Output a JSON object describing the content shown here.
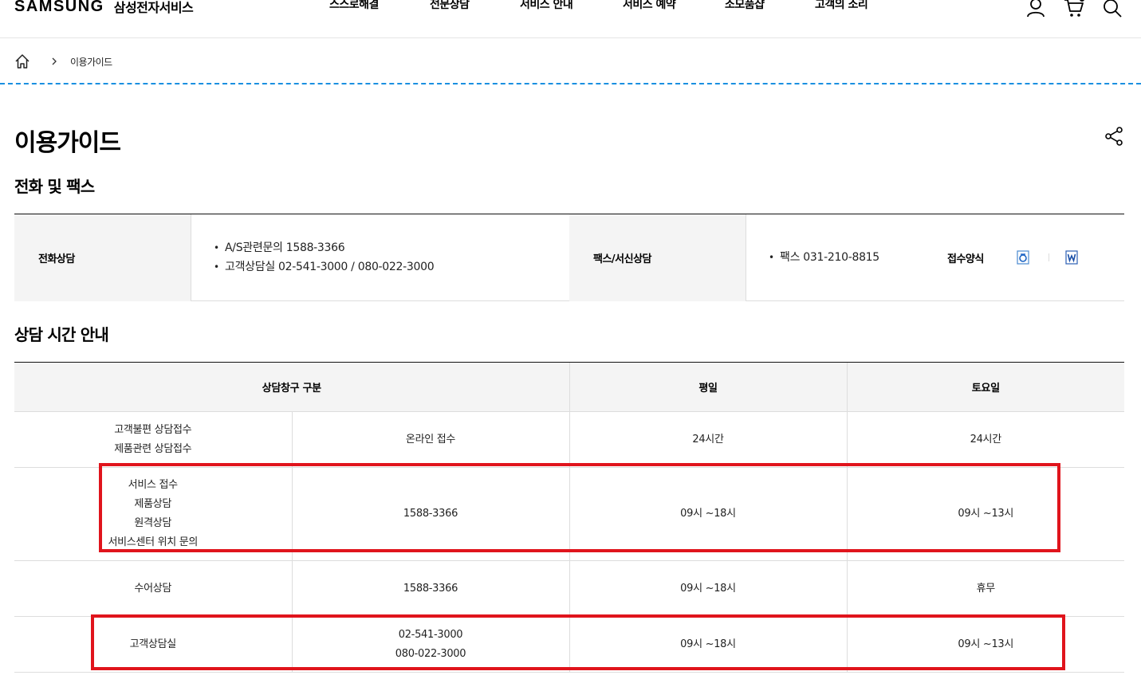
{
  "header": {
    "brand": "SAMSUNG",
    "brand_sub": "삼성전자서비스",
    "nav": [
      "스스로해결",
      "전문상담",
      "서비스 안내",
      "서비스 예약",
      "소모품샵",
      "고객의 소리"
    ]
  },
  "breadcrumb": {
    "current": "이용가이드"
  },
  "page_title": "이용가이드",
  "contact_section": {
    "title": "전화 및 팩스",
    "phone_label": "전화상담",
    "phone_items": [
      "A/S관련문의 1588-3366",
      "고객상담실 02-541-3000 / 080-022-3000"
    ],
    "fax_label": "팩스/서신상담",
    "fax_items": [
      "팩스 031-210-8815"
    ],
    "form_label": "접수양식",
    "form_icons": [
      "hwp-file-icon",
      "word-file-icon"
    ]
  },
  "hours_section": {
    "title": "상담 시간 안내",
    "headers": [
      "상담창구 구분",
      "평일",
      "토요일"
    ],
    "rows": [
      {
        "category": [
          "고객불편 상담접수",
          "제품관련 상담접수"
        ],
        "channel": [
          "온라인 접수"
        ],
        "weekday": "24시간",
        "saturday": "24시간"
      },
      {
        "category": [
          "서비스 접수",
          "제품상담",
          "원격상담",
          "서비스센터 위치 문의"
        ],
        "channel": [
          "1588-3366"
        ],
        "weekday": "09시 ~18시",
        "saturday": "09시 ~13시"
      },
      {
        "category": [
          "수어상담"
        ],
        "channel": [
          "1588-3366"
        ],
        "weekday": "09시 ~18시",
        "saturday": "휴무"
      },
      {
        "category": [
          "고객상담실"
        ],
        "channel": [
          "02-541-3000",
          "080-022-3000"
        ],
        "weekday": "09시 ~18시",
        "saturday": "09시 ~13시"
      }
    ]
  },
  "colors": {
    "highlight": "#e0141c",
    "dashed_divider": "#1a8fe0",
    "header_bg": "#f4f4f4"
  }
}
